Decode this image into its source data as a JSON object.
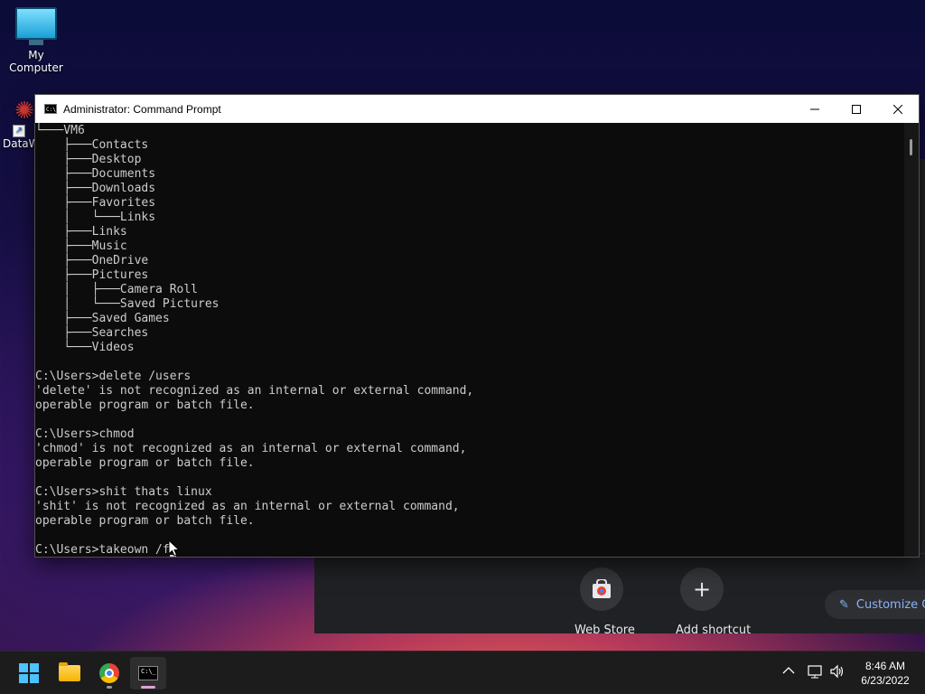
{
  "desktop": {
    "icons": [
      {
        "label": "My Computer"
      },
      {
        "label": "DataW"
      }
    ]
  },
  "browser": {
    "shortcuts": [
      {
        "label": "Web Store"
      },
      {
        "label": "Add shortcut"
      }
    ],
    "customize_label": "Customize C"
  },
  "cmd": {
    "title": "Administrator: Command Prompt",
    "lines": [
      "└───VM6",
      "    ├───Contacts",
      "    ├───Desktop",
      "    ├───Documents",
      "    ├───Downloads",
      "    ├───Favorites",
      "    │   └───Links",
      "    ├───Links",
      "    ├───Music",
      "    ├───OneDrive",
      "    ├───Pictures",
      "    │   ├───Camera Roll",
      "    │   └───Saved Pictures",
      "    ├───Saved Games",
      "    ├───Searches",
      "    └───Videos",
      "",
      "C:\\Users>delete /users",
      "'delete' is not recognized as an internal or external command,",
      "operable program or batch file.",
      "",
      "C:\\Users>chmod",
      "'chmod' is not recognized as an internal or external command,",
      "operable program or batch file.",
      "",
      "C:\\Users>shit thats linux",
      "'shit' is not recognized as an internal or external command,",
      "operable program or batch file.",
      ""
    ],
    "prompt_input": "C:\\Users>takeown /f"
  },
  "taskbar": {
    "time": "8:46 AM",
    "date": "6/23/2022"
  }
}
